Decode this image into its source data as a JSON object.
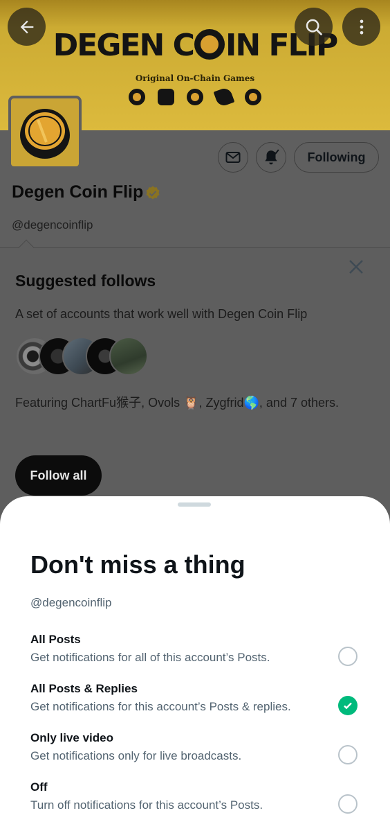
{
  "banner": {
    "title_part1": "DEGEN C",
    "title_part2": "IN FLIP",
    "subtitle": "Original On-Chain Games",
    "icons": [
      "coin-icon",
      "cat-icon",
      "bird-icon",
      "rocket-icon",
      "pagoda-icon"
    ]
  },
  "header": {
    "back_icon": "arrow-left-icon",
    "search_icon": "search-icon",
    "more_icon": "more-vertical-icon"
  },
  "profile": {
    "name": "Degen Coin Flip",
    "handle": "@degencoinflip",
    "verified_color": "#e2b719",
    "following_label": "Following",
    "mail_icon": "mail-icon",
    "bell_icon": "bell-check-icon"
  },
  "suggested": {
    "title": "Suggested follows",
    "description": "A set of accounts that work well with Degen Coin Flip",
    "featuring": "Featuring ChartFu猴子, Ovols 🦉, Zygfrid🌎, and 7 others.",
    "follow_all_label": "Follow all"
  },
  "sheet": {
    "title": "Don't miss a thing",
    "handle": "@degencoinflip",
    "accent_color": "#00ba7c",
    "options": [
      {
        "label": "All Posts",
        "description": "Get notifications for all of this account’s Posts.",
        "selected": false
      },
      {
        "label": "All Posts & Replies",
        "description": "Get notifications for this account’s Posts & replies.",
        "selected": true
      },
      {
        "label": "Only live video",
        "description": "Get notifications only for live broadcasts.",
        "selected": false
      },
      {
        "label": "Off",
        "description": "Turn off notifications for this account’s Posts.",
        "selected": false
      }
    ]
  }
}
